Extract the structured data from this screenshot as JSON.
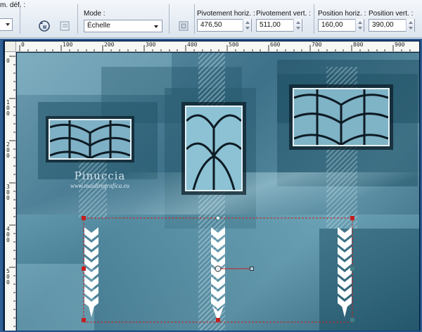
{
  "toolbar": {
    "preset_label": "m. déf. :",
    "mode_label": "Mode :",
    "mode_value": "Échelle",
    "rot_h_label": "Pivotement horiz. :",
    "rot_h_value": "476,50",
    "rot_v_label": "Pivotement vert. :",
    "rot_v_value": "511,00",
    "pos_h_label": "Position horiz. :",
    "pos_h_value": "160,00",
    "pos_v_label": "Position vert. :",
    "pos_v_value": "390,00"
  },
  "ruler": {
    "top_ticks": [
      "0",
      "100",
      "200",
      "300",
      "400",
      "500",
      "600",
      "700",
      "800",
      "900"
    ],
    "left_ticks": [
      "0",
      "100",
      "200",
      "300",
      "400",
      "500"
    ]
  },
  "watermark": {
    "name": "Pinuccia",
    "url": "www.maidiregrafica.eu"
  },
  "colors": {
    "canvas_base": "#4d8097",
    "teal_dark": "#1f4f63",
    "teal_light": "#a8d6e2",
    "selection_red": "#c41f1f",
    "handle_teal": "#3f7f86"
  }
}
